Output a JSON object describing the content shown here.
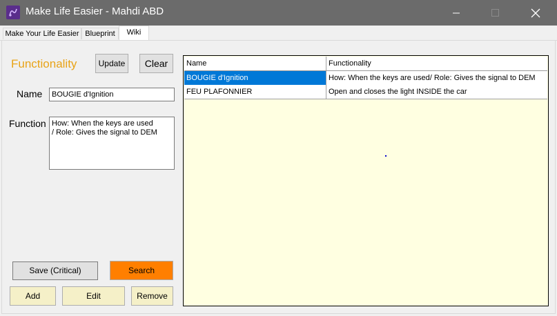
{
  "window": {
    "title": "Make Life Easier - Mahdi ABD",
    "icon": "app-logo-icon",
    "controls": [
      "minimize-icon",
      "maximize-icon",
      "close-icon"
    ]
  },
  "tabs": [
    {
      "label": "Make Your Life Easier",
      "active": false
    },
    {
      "label": "Blueprint",
      "active": false
    },
    {
      "label": "Wiki",
      "active": true
    }
  ],
  "form": {
    "heading": "Functionality",
    "update_label": "Update",
    "clear_label": "Clear",
    "name_label": "Name",
    "name_value": "BOUGIE d'Ignition",
    "function_label": "Function",
    "function_value": "How: When the keys are used\n/ Role: Gives the signal to DEM"
  },
  "actions": {
    "save_label": "Save (Critical)",
    "search_label": "Search",
    "add_label": "Add",
    "edit_label": "Edit",
    "remove_label": "Remove"
  },
  "table": {
    "columns": [
      "Name",
      "Functionality"
    ],
    "rows": [
      {
        "name": "BOUGIE d'Ignition",
        "functionality": "How: When the keys are used/ Role: Gives the signal to DEM",
        "selected": true
      },
      {
        "name": "FEU PLAFONNIER",
        "functionality": "Open and closes the light INSIDE the car",
        "selected": false
      }
    ]
  },
  "colors": {
    "accent_heading": "#e8a317",
    "search_button": "#ff7f00",
    "action_buttons": "#f5f0c8",
    "selection": "#0078d7",
    "grid_background": "#ffffe1"
  }
}
